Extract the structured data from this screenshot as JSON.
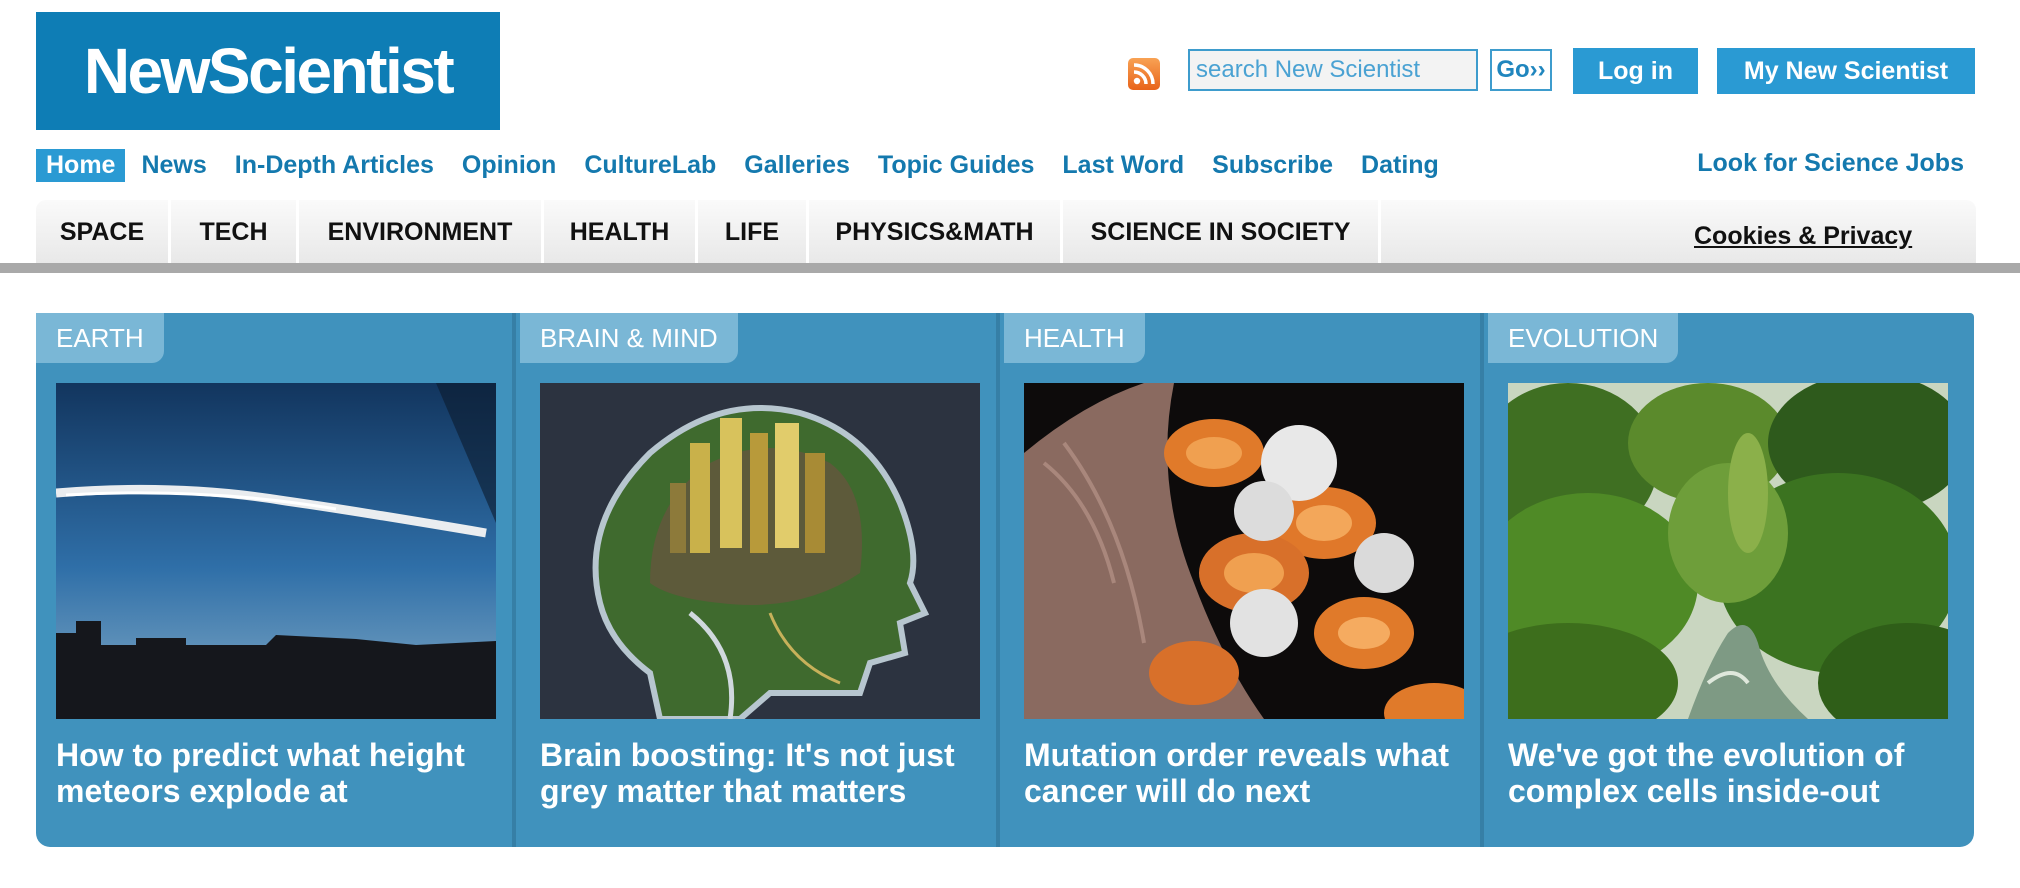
{
  "brand": {
    "logo_text": "NewScientist",
    "color": "#0e7db5"
  },
  "header": {
    "rss_icon": "rss-icon",
    "search_placeholder": "search New Scientist",
    "go_label": "Go››",
    "login_label": "Log in",
    "my_account_label": "My New Scientist"
  },
  "nav": {
    "items": [
      "Home",
      "News",
      "In-Depth Articles",
      "Opinion",
      "CultureLab",
      "Galleries",
      "Topic Guides",
      "Last Word",
      "Subscribe",
      "Dating"
    ],
    "jobs": "Look for Science Jobs"
  },
  "categories": {
    "items": [
      "SPACE",
      "TECH",
      "ENVIRONMENT",
      "HEALTH",
      "LIFE",
      "PHYSICS&MATH",
      "SCIENCE IN SOCIETY"
    ],
    "cookies": "Cookies & Privacy"
  },
  "features": [
    {
      "tag": "EARTH",
      "headline": "How to predict what height meteors explode at",
      "image": "meteor-trail-sky"
    },
    {
      "tag": "BRAIN & MIND",
      "headline": "Brain boosting: It's not just grey matter that matters",
      "image": "city-inside-head"
    },
    {
      "tag": "HEALTH",
      "headline": "Mutation order reveals what cancer will do next",
      "image": "blood-cells-micrograph"
    },
    {
      "tag": "EVOLUTION",
      "headline": "We've got the evolution of complex cells inside-out",
      "image": "rainforest-river"
    }
  ],
  "colors": {
    "accent": "#2a9ad3",
    "nav_text": "#1479ae",
    "panel": "#4092bd"
  }
}
